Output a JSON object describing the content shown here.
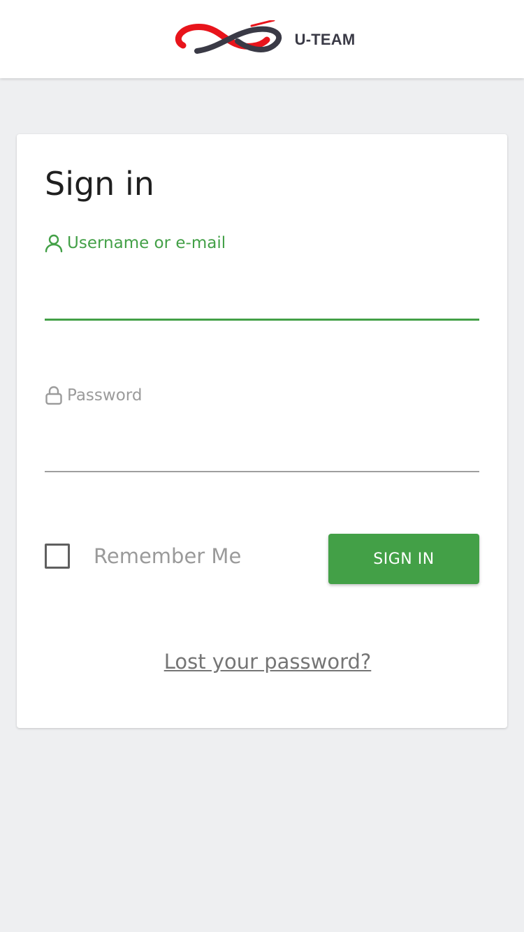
{
  "header": {
    "brand_name": "U-TEAM",
    "logo_colors": {
      "red": "#e8141b",
      "dark": "#3a3a46"
    }
  },
  "form": {
    "title": "Sign in",
    "username": {
      "label": "Username or e-mail",
      "value": "",
      "icon": "user-icon"
    },
    "password": {
      "label": "Password",
      "value": "",
      "icon": "lock-icon"
    },
    "remember_me": {
      "label": "Remember Me",
      "checked": false
    },
    "submit_label": "SIGN IN",
    "lost_password_label": "Lost your password?"
  },
  "colors": {
    "accent": "#43a047",
    "background": "#eeeff1",
    "muted_text": "#9b9b9b"
  }
}
